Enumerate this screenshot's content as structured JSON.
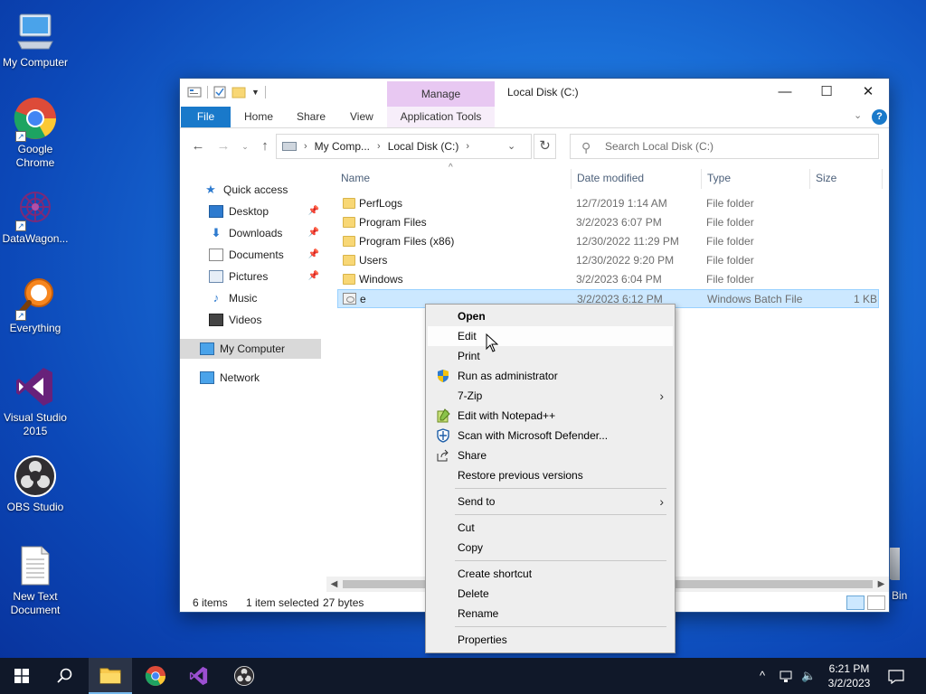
{
  "desktop": {
    "icons": [
      {
        "label": "My Computer"
      },
      {
        "label": "Google Chrome"
      },
      {
        "label": "DataWagon..."
      },
      {
        "label": "Everything"
      },
      {
        "label": "Visual Studio 2015"
      },
      {
        "label": "OBS Studio"
      },
      {
        "label": "New Text Document"
      }
    ],
    "recycle_bin_partial": "Bin"
  },
  "window": {
    "title": "Local Disk (C:)",
    "manage_tab": "Manage",
    "ribbon_tabs": [
      "File",
      "Home",
      "Share",
      "View",
      "Application Tools"
    ],
    "address": {
      "crumbs": [
        "My Comp...",
        "Local Disk (C:)"
      ]
    },
    "search_placeholder": "Search Local Disk (C:)",
    "nav_pane": [
      {
        "label": "Quick access",
        "icon": "star-icon"
      },
      {
        "label": "Desktop",
        "icon": "desktop-icon",
        "pinned": true
      },
      {
        "label": "Downloads",
        "icon": "download-icon",
        "pinned": true
      },
      {
        "label": "Documents",
        "icon": "documents-icon",
        "pinned": true
      },
      {
        "label": "Pictures",
        "icon": "pictures-icon",
        "pinned": true
      },
      {
        "label": "Music",
        "icon": "music-icon"
      },
      {
        "label": "Videos",
        "icon": "videos-icon"
      },
      {
        "label": "My Computer",
        "icon": "computer-icon",
        "selected": true
      },
      {
        "label": "Network",
        "icon": "network-icon"
      }
    ],
    "columns": [
      "Name",
      "Date modified",
      "Type",
      "Size"
    ],
    "files": [
      {
        "name": "PerfLogs",
        "date": "12/7/2019 1:14 AM",
        "type": "File folder",
        "size": "",
        "kind": "folder"
      },
      {
        "name": "Program Files",
        "date": "3/2/2023 6:07 PM",
        "type": "File folder",
        "size": "",
        "kind": "folder"
      },
      {
        "name": "Program Files (x86)",
        "date": "12/30/2022 11:29 PM",
        "type": "File folder",
        "size": "",
        "kind": "folder"
      },
      {
        "name": "Users",
        "date": "12/30/2022 9:20 PM",
        "type": "File folder",
        "size": "",
        "kind": "folder"
      },
      {
        "name": "Windows",
        "date": "3/2/2023 6:04 PM",
        "type": "File folder",
        "size": "",
        "kind": "folder"
      },
      {
        "name": "e",
        "date": "3/2/2023 6:12 PM",
        "type": "Windows Batch File",
        "size": "1 KB",
        "kind": "bat",
        "selected": true
      }
    ],
    "status": {
      "items": "6 items",
      "selected": "1 item selected",
      "bytes": "27 bytes"
    }
  },
  "context_menu": {
    "items": [
      {
        "label": "Open",
        "bold": true
      },
      {
        "label": "Edit",
        "hover": true
      },
      {
        "label": "Print"
      },
      {
        "label": "Run as administrator",
        "icon": "shield-icon"
      },
      {
        "label": "7-Zip",
        "submenu": true
      },
      {
        "label": "Edit with Notepad++",
        "icon": "notepadpp-icon"
      },
      {
        "label": "Scan with Microsoft Defender...",
        "icon": "defender-icon"
      },
      {
        "label": "Share",
        "icon": "share-icon"
      },
      {
        "label": "Restore previous versions"
      },
      {
        "separator": true
      },
      {
        "label": "Send to",
        "submenu": true
      },
      {
        "separator": true
      },
      {
        "label": "Cut"
      },
      {
        "label": "Copy"
      },
      {
        "separator": true
      },
      {
        "label": "Create shortcut"
      },
      {
        "label": "Delete"
      },
      {
        "label": "Rename"
      },
      {
        "separator": true
      },
      {
        "label": "Properties"
      }
    ]
  },
  "taskbar": {
    "clock_time": "6:21 PM",
    "clock_date": "3/2/2023",
    "accent": "#76b9ed"
  }
}
